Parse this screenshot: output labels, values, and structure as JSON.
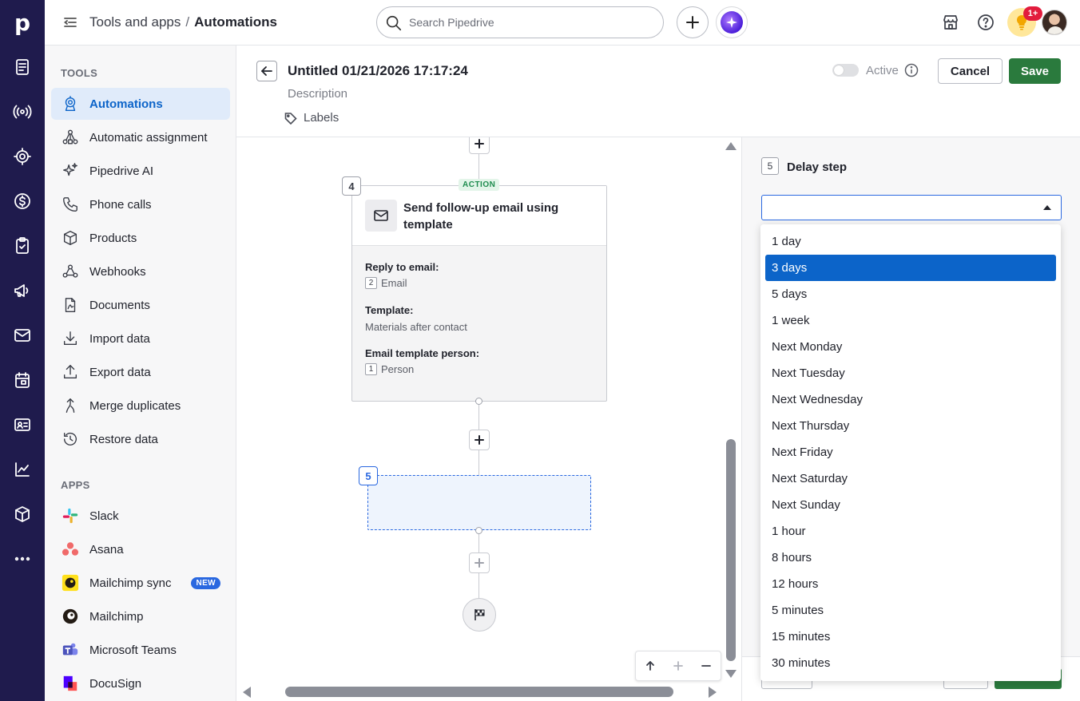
{
  "header": {
    "breadcrumb_parent": "Tools and apps",
    "breadcrumb_sep": "/",
    "breadcrumb_current": "Automations",
    "search_placeholder": "Search Pipedrive",
    "notification_count": "1+"
  },
  "rail": {
    "logo": "p",
    "icons": [
      "leads-icon",
      "campaigns-icon",
      "target-icon",
      "deals-icon",
      "activities-icon",
      "megaphone-icon",
      "mail-icon",
      "calendar-icon",
      "contacts-icon",
      "insights-icon",
      "products-icon",
      "more-icon"
    ]
  },
  "sidebar": {
    "tools_heading": "TOOLS",
    "tools": [
      {
        "label": "Automations",
        "icon": "automation-icon",
        "active": true
      },
      {
        "label": "Automatic assignment",
        "icon": "assignment-icon"
      },
      {
        "label": "Pipedrive AI",
        "icon": "sparkle-icon"
      },
      {
        "label": "Phone calls",
        "icon": "phone-icon"
      },
      {
        "label": "Products",
        "icon": "box-icon"
      },
      {
        "label": "Webhooks",
        "icon": "webhook-icon"
      },
      {
        "label": "Documents",
        "icon": "document-icon"
      },
      {
        "label": "Import data",
        "icon": "import-icon"
      },
      {
        "label": "Export data",
        "icon": "export-icon"
      },
      {
        "label": "Merge duplicates",
        "icon": "merge-icon"
      },
      {
        "label": "Restore data",
        "icon": "restore-icon"
      }
    ],
    "apps_heading": "APPS",
    "apps": [
      {
        "label": "Slack",
        "icon": "slack-icon"
      },
      {
        "label": "Asana",
        "icon": "asana-icon"
      },
      {
        "label": "Mailchimp sync",
        "icon": "mailchimp-icon",
        "badge": "NEW"
      },
      {
        "label": "Mailchimp",
        "icon": "mailchimp-icon"
      },
      {
        "label": "Microsoft Teams",
        "icon": "teams-icon"
      },
      {
        "label": "DocuSign",
        "icon": "docusign-icon"
      }
    ]
  },
  "automation": {
    "title": "Untitled 01/21/2026 17:17:24",
    "description_placeholder": "Description",
    "labels_link": "Labels",
    "active_label": "Active",
    "active_on": false,
    "cancel_label": "Cancel",
    "save_label": "Save"
  },
  "canvas": {
    "action_step": {
      "number": "4",
      "tag": "ACTION",
      "title": "Send follow-up email using template",
      "fields": [
        {
          "label": "Reply to email:",
          "ref": "2",
          "value": "Email"
        },
        {
          "label": "Template:",
          "ref": "",
          "value": "Materials after contact"
        },
        {
          "label": "Email template person:",
          "ref": "1",
          "value": "Person"
        }
      ]
    },
    "new_step_number": "5"
  },
  "panel": {
    "step_number": "5",
    "title": "Delay step",
    "select_value": "",
    "options": [
      "1 day",
      "3 days",
      "5 days",
      "1 week",
      "Next Monday",
      "Next Tuesday",
      "Next Wednesday",
      "Next Thursday",
      "Next Friday",
      "Next Saturday",
      "Next Sunday",
      "1 hour",
      "8 hours",
      "12 hours",
      "5 minutes",
      "15 minutes",
      "30 minutes"
    ],
    "highlighted_option": "3 days"
  },
  "colors": {
    "rail_bg": "#1f1b4d",
    "accent_blue": "#0c64c9",
    "save_green": "#2a7a3d",
    "action_tag_green": "#1e8c4e"
  }
}
